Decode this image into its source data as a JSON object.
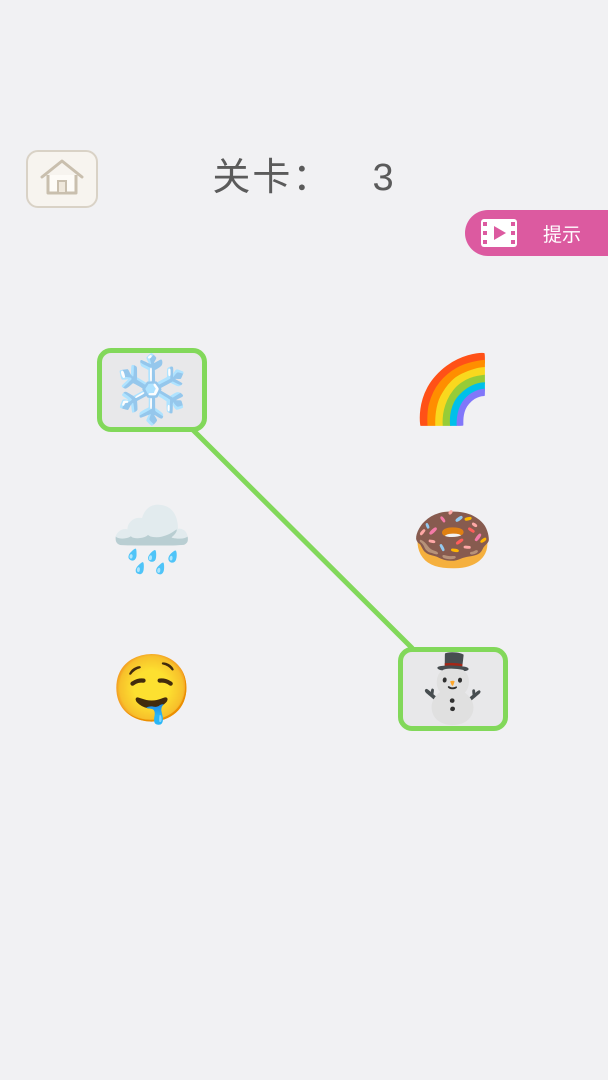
{
  "header": {
    "home_icon": "home-icon",
    "level_label": "关卡：",
    "level_number": "3"
  },
  "hint": {
    "icon": "video-play-icon",
    "label": "提示"
  },
  "colors": {
    "background": "#f1f1f3",
    "hint_button": "#dc5aa0",
    "selection": "#82d85a",
    "title_text": "#5b5b5b"
  },
  "tiles": [
    {
      "name": "snowflake",
      "emoji": "❄️",
      "selected": true
    },
    {
      "name": "rainbow",
      "emoji": "🌈",
      "selected": false
    },
    {
      "name": "rain-cloud",
      "emoji": "🌧️",
      "selected": false
    },
    {
      "name": "doughnut",
      "emoji": "🍩",
      "selected": false
    },
    {
      "name": "drooling-face",
      "emoji": "🤤",
      "selected": false
    },
    {
      "name": "snowman",
      "emoji": "⛄",
      "selected": true
    }
  ],
  "connection": {
    "from": "snowflake",
    "to": "snowman"
  }
}
